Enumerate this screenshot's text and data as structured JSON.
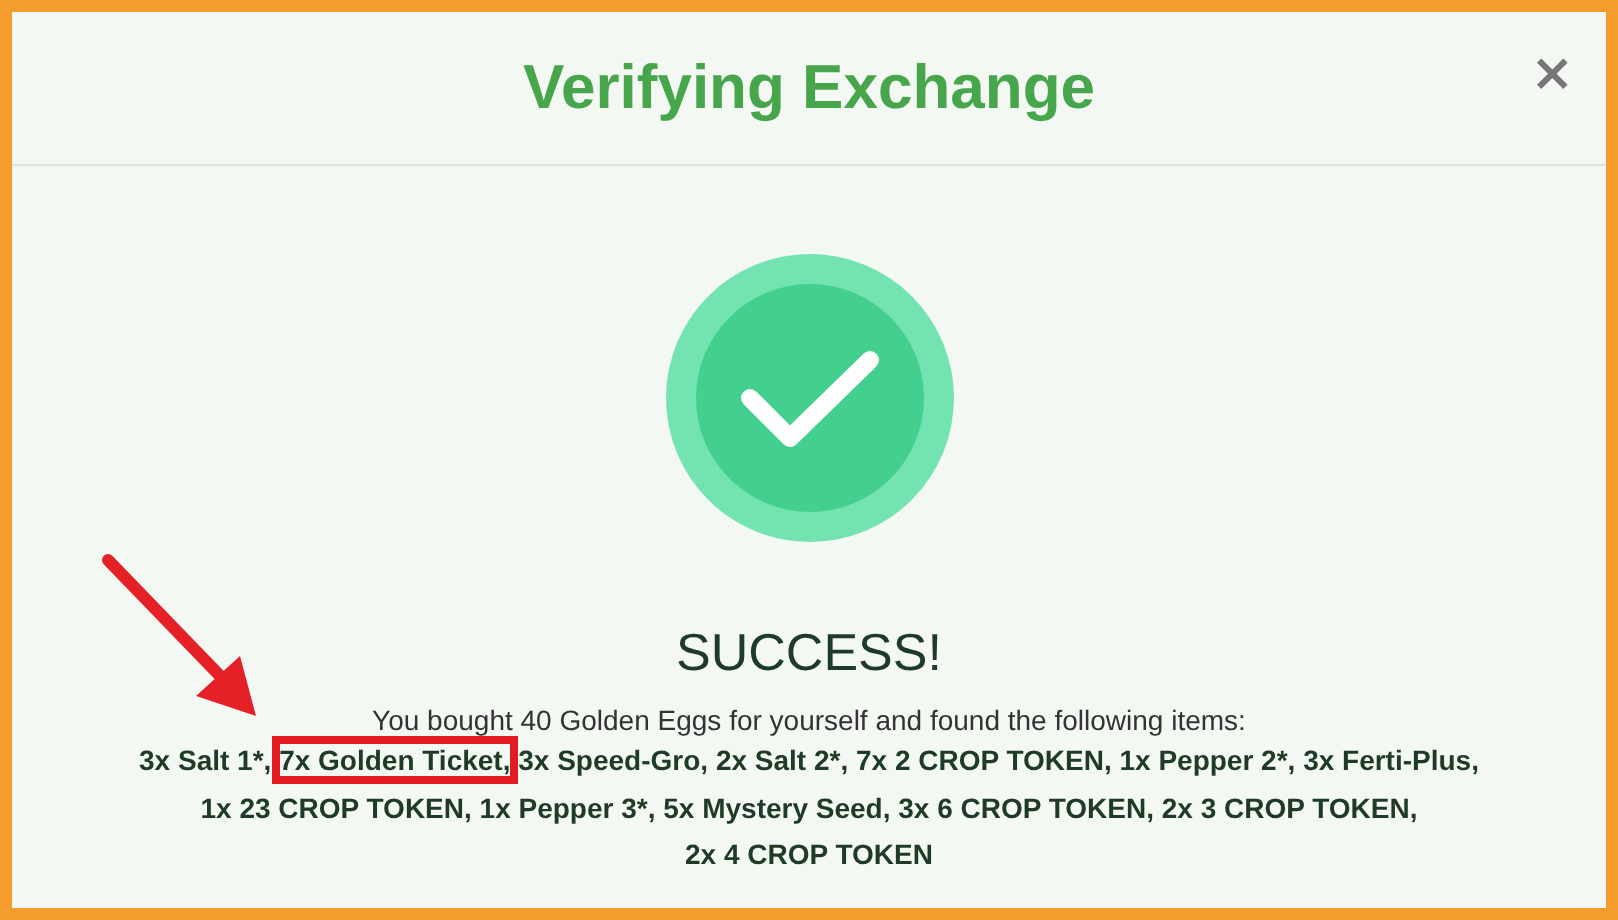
{
  "dialog": {
    "title": "Verifying Exchange",
    "close": "×"
  },
  "status": {
    "kind": "success",
    "heading": "SUCCESS!"
  },
  "message": "You bought 40 Golden Eggs for yourself and found the following items:",
  "items": [
    {
      "text": "3x Salt 1*,",
      "highlighted": false
    },
    {
      "text": "7x Golden Ticket,",
      "highlighted": true
    },
    {
      "text": "3x Speed-Gro,",
      "highlighted": false
    },
    {
      "text": "2x Salt 2*,",
      "highlighted": false
    },
    {
      "text": "7x 2 CROP TOKEN,",
      "highlighted": false
    },
    {
      "text": "1x Pepper 2*,",
      "highlighted": false
    },
    {
      "text": "3x Ferti-Plus,",
      "highlighted": false
    },
    {
      "text": "1x 23 CROP TOKEN,",
      "highlighted": false
    },
    {
      "text": "1x Pepper 3*,",
      "highlighted": false
    },
    {
      "text": "5x Mystery Seed,",
      "highlighted": false
    },
    {
      "text": "3x 6 CROP TOKEN,",
      "highlighted": false
    },
    {
      "text": "2x 3 CROP TOKEN,",
      "highlighted": false
    },
    {
      "text": "2x 4 CROP TOKEN",
      "highlighted": false
    }
  ],
  "annotation": {
    "kind": "arrow"
  }
}
